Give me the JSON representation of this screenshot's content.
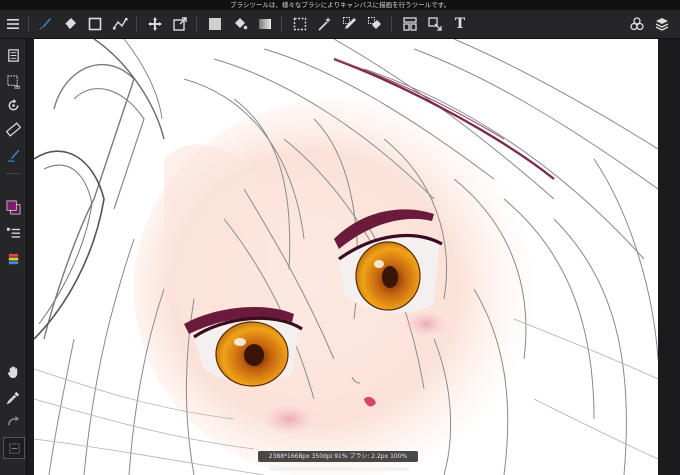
{
  "hint": {
    "text": "ブラシツールは、様々なブラシによりキャンバスに描画を行うツールです。"
  },
  "toolbar": {
    "icons": [
      "menu-icon",
      "brush-tool-icon",
      "eraser-tool-icon",
      "rectangle-tool-icon",
      "vector-tool-icon",
      "move-tool-icon",
      "transform-tool-icon",
      "color-fill-swatch-icon",
      "bucket-tool-icon",
      "gradient-tool-icon",
      "selection-rect-icon",
      "magic-wand-icon",
      "selection-pen-icon",
      "selection-eraser-icon",
      "layer-panel-icon",
      "reference-tool-icon",
      "text-tool-icon",
      "material-icon",
      "layers-icon"
    ],
    "text_tool_label": "T"
  },
  "sidebar": {
    "icons": [
      "pages-icon",
      "selection-layer-icon",
      "rotate-icon",
      "ruler-icon",
      "brush-picker-icon",
      "color-swatch-icon",
      "layer-list-icon",
      "layer-properties-icon",
      "hand-tool-icon",
      "eyedropper-icon",
      "redo-icon",
      "undo-icon"
    ]
  },
  "status": {
    "text": "2388*1668px 350dpi 91% ブラシ: 2.2px 100%"
  },
  "colors": {
    "foreground_swatch": "#7d1a6f",
    "background_swatch": "#5a1a4a",
    "active_tool_accent": "#3b8bdc"
  }
}
